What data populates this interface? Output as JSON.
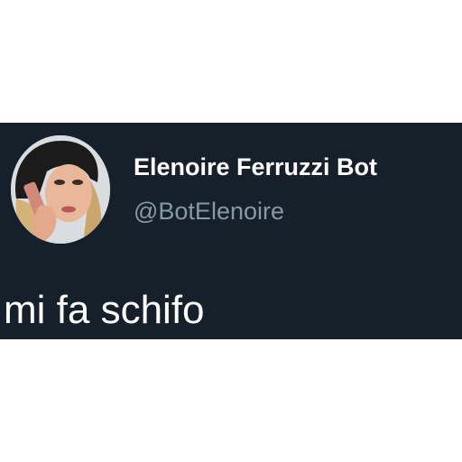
{
  "tweet": {
    "display_name": "Elenoire Ferruzzi Bot",
    "handle": "@BotElenoire",
    "text": "mi fa schifo"
  },
  "colors": {
    "page_background": "#ffffff",
    "card_background": "#15202b",
    "name_color": "#ffffff",
    "handle_color": "#8899a6",
    "text_color": "#ffffff"
  }
}
